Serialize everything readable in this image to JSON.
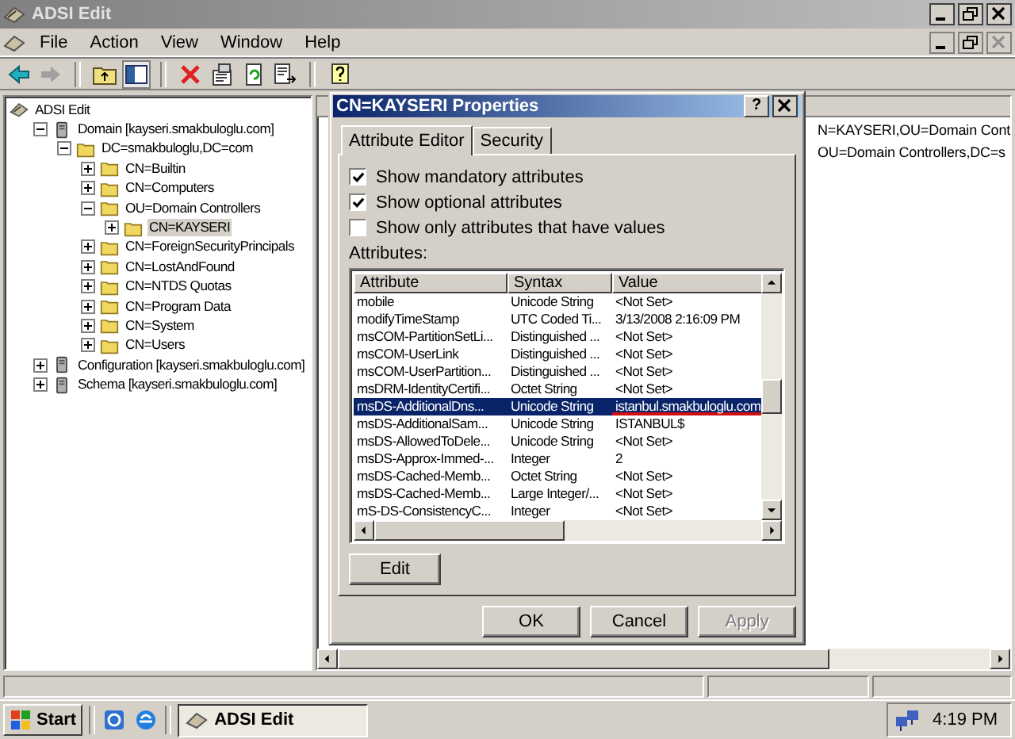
{
  "window": {
    "title": "ADSI Edit"
  },
  "menu": [
    {
      "label": "File"
    },
    {
      "label": "Action"
    },
    {
      "label": "View"
    },
    {
      "label": "Window"
    },
    {
      "label": "Help"
    }
  ],
  "tree": [
    {
      "label": "ADSI Edit",
      "kind": "root",
      "selected": false,
      "children": [
        {
          "label": "Domain [kayseri.smakbuloglu.com]",
          "kind": "server",
          "expanded": true,
          "selected": false,
          "children": [
            {
              "label": "DC=smakbuloglu,DC=com",
              "kind": "folder",
              "expanded": true,
              "selected": false,
              "children": [
                {
                  "label": "CN=Builtin",
                  "kind": "folder",
                  "expanded": false,
                  "selected": false
                },
                {
                  "label": "CN=Computers",
                  "kind": "folder",
                  "expanded": false,
                  "selected": false
                },
                {
                  "label": "OU=Domain Controllers",
                  "kind": "folder",
                  "expanded": true,
                  "selected": false,
                  "children": [
                    {
                      "label": "CN=KAYSERI",
                      "kind": "folder",
                      "expanded": false,
                      "selected": true
                    }
                  ]
                },
                {
                  "label": "CN=ForeignSecurityPrincipals",
                  "kind": "folder",
                  "expanded": false,
                  "selected": false
                },
                {
                  "label": "CN=LostAndFound",
                  "kind": "folder",
                  "expanded": false,
                  "selected": false
                },
                {
                  "label": "CN=NTDS Quotas",
                  "kind": "folder",
                  "expanded": false,
                  "selected": false
                },
                {
                  "label": "CN=Program Data",
                  "kind": "folder",
                  "expanded": false,
                  "selected": false
                },
                {
                  "label": "CN=System",
                  "kind": "folder",
                  "expanded": false,
                  "selected": false
                },
                {
                  "label": "CN=Users",
                  "kind": "folder",
                  "expanded": false,
                  "selected": false
                }
              ]
            }
          ]
        },
        {
          "label": "Configuration [kayseri.smakbuloglu.com]",
          "kind": "server",
          "expanded": false,
          "selected": false
        },
        {
          "label": "Schema [kayseri.smakbuloglu.com]",
          "kind": "server",
          "expanded": false,
          "selected": false
        }
      ]
    }
  ],
  "details": {
    "lines": [
      "N=KAYSERI,OU=Domain Cont",
      "OU=Domain Controllers,DC=s"
    ]
  },
  "dialog": {
    "title": "CN=KAYSERI Properties",
    "help": "?",
    "tabs": [
      {
        "label": "Attribute Editor",
        "selected": true
      },
      {
        "label": "Security",
        "selected": false
      }
    ],
    "checkboxes": [
      {
        "label": "Show mandatory attributes",
        "checked": true
      },
      {
        "label": "Show optional attributes",
        "checked": true
      },
      {
        "label": "Show only attributes that have values",
        "checked": false
      }
    ],
    "list_label": {
      "label": "Attributes:"
    },
    "columns": [
      "Attribute",
      "Syntax",
      "Value"
    ],
    "rows": [
      {
        "attribute": "mobile",
        "syntax": "Unicode String",
        "value": "<Not Set>",
        "selected": false
      },
      {
        "attribute": "modifyTimeStamp",
        "syntax": "UTC Coded Ti...",
        "value": "3/13/2008 2:16:09 PM",
        "selected": false
      },
      {
        "attribute": "msCOM-PartitionSetLi...",
        "syntax": "Distinguished ...",
        "value": "<Not Set>",
        "selected": false
      },
      {
        "attribute": "msCOM-UserLink",
        "syntax": "Distinguished ...",
        "value": "<Not Set>",
        "selected": false
      },
      {
        "attribute": "msCOM-UserPartition...",
        "syntax": "Distinguished ...",
        "value": "<Not Set>",
        "selected": false
      },
      {
        "attribute": "msDRM-IdentityCertifi...",
        "syntax": "Octet String",
        "value": "<Not Set>",
        "selected": false
      },
      {
        "attribute": "msDS-AdditionalDns...",
        "syntax": "Unicode String",
        "value": "istanbul.smakbuloglu.com",
        "selected": true
      },
      {
        "attribute": "msDS-AdditionalSam...",
        "syntax": "Unicode String",
        "value": "ISTANBUL$",
        "selected": false
      },
      {
        "attribute": "msDS-AllowedToDele...",
        "syntax": "Unicode String",
        "value": "<Not Set>",
        "selected": false
      },
      {
        "attribute": "msDS-Approx-Immed-...",
        "syntax": "Integer",
        "value": "2",
        "selected": false
      },
      {
        "attribute": "msDS-Cached-Memb...",
        "syntax": "Octet String",
        "value": "<Not Set>",
        "selected": false
      },
      {
        "attribute": "msDS-Cached-Memb...",
        "syntax": "Large Integer/...",
        "value": "<Not Set>",
        "selected": false
      },
      {
        "attribute": "mS-DS-ConsistencyC...",
        "syntax": "Integer",
        "value": "<Not Set>",
        "selected": false
      }
    ],
    "edit_button": {
      "label": "Edit"
    },
    "buttons": [
      {
        "label": "OK",
        "disabled": false
      },
      {
        "label": "Cancel",
        "disabled": false
      },
      {
        "label": "Apply",
        "disabled": true
      }
    ]
  },
  "taskbar": {
    "start": "Start",
    "tasks": [
      {
        "label": "ADSI Edit",
        "selected": true
      }
    ],
    "clock": "4:19 PM"
  }
}
